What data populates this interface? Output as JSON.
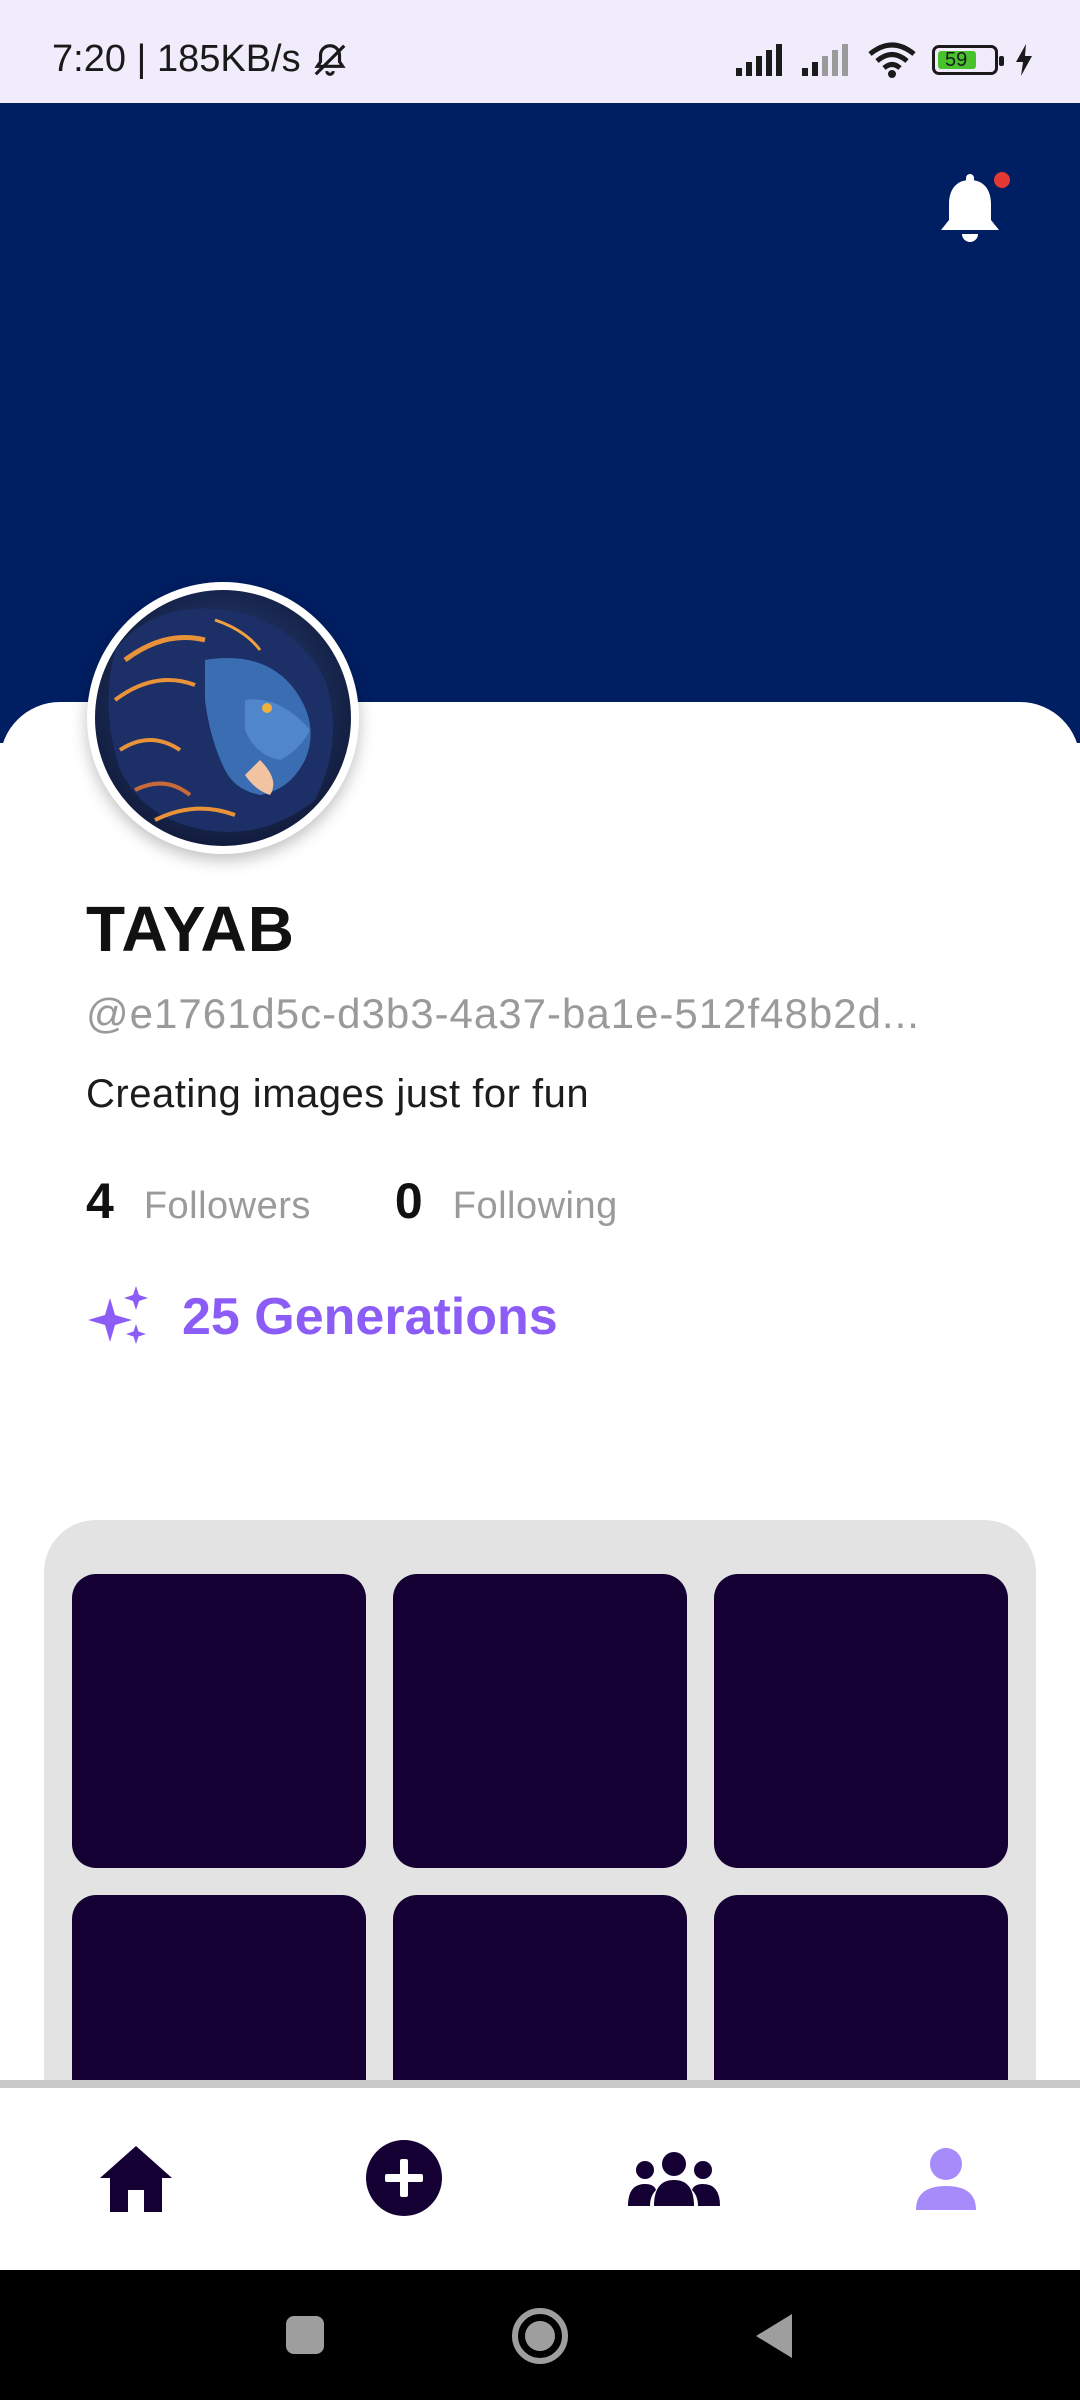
{
  "status_bar": {
    "time_speed": "7:20 | 185KB/s",
    "battery_level": "59"
  },
  "profile": {
    "name": "TAYAB",
    "handle": "@e1761d5c-d3b3-4a37-ba1e-512f48b2d...",
    "bio": "Creating images just for fun",
    "followers_count": "4",
    "followers_label": "Followers",
    "following_count": "0",
    "following_label": "Following",
    "generations_label": "25 Generations"
  },
  "gallery": {
    "tile_count": 6
  },
  "bottom_nav": {
    "items": [
      "home-icon",
      "add-circle-icon",
      "community-icon",
      "profile-icon"
    ],
    "active": "profile-icon"
  },
  "colors": {
    "header": "#001e62",
    "accent": "#8b5cf6",
    "tile": "#140033",
    "notification_dot": "#e53935"
  }
}
